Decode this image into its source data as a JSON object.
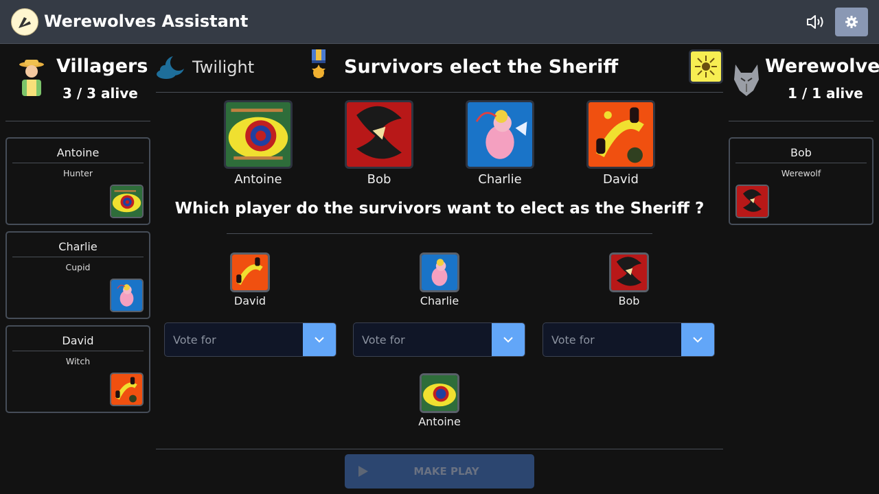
{
  "app": {
    "title": "Werewolves Assistant"
  },
  "header": {
    "sound_icon": "speaker-icon",
    "settings_icon": "gear-icon"
  },
  "villagers": {
    "title": "Villagers",
    "alive": "3 / 3 alive",
    "players": [
      {
        "name": "Antoine",
        "role": "Hunter",
        "card": "hunter"
      },
      {
        "name": "Charlie",
        "role": "Cupid",
        "card": "cupid"
      },
      {
        "name": "David",
        "role": "Witch",
        "card": "witch"
      }
    ]
  },
  "werewolves": {
    "title": "Werewolves",
    "alive": "1 / 1 alive",
    "players": [
      {
        "name": "Bob",
        "role": "Werewolf",
        "card": "werewolf"
      }
    ]
  },
  "phase": {
    "label": "Twilight",
    "icon": "moon-cloud-icon"
  },
  "step": {
    "title": "Survivors elect the Sheriff",
    "icon": "medal-icon",
    "side_card": "sun-card"
  },
  "cards": [
    {
      "name": "Antoine",
      "card": "hunter"
    },
    {
      "name": "Bob",
      "card": "werewolf"
    },
    {
      "name": "Charlie",
      "card": "cupid"
    },
    {
      "name": "David",
      "card": "witch"
    }
  ],
  "question": "Which player do the survivors want to elect as the Sheriff ?",
  "voters": [
    {
      "name": "David",
      "card": "witch",
      "placeholder": "Vote for"
    },
    {
      "name": "Charlie",
      "card": "cupid",
      "placeholder": "Vote for"
    },
    {
      "name": "Bob",
      "card": "werewolf",
      "placeholder": "Vote for"
    },
    {
      "name": "Antoine",
      "card": "hunter"
    }
  ],
  "actions": {
    "make_play": "MAKE PLAY"
  },
  "colors": {
    "topbar": "#353b45",
    "accent": "#62a6f8",
    "settings": "#8a98b4",
    "play_button": "#2c4670"
  }
}
